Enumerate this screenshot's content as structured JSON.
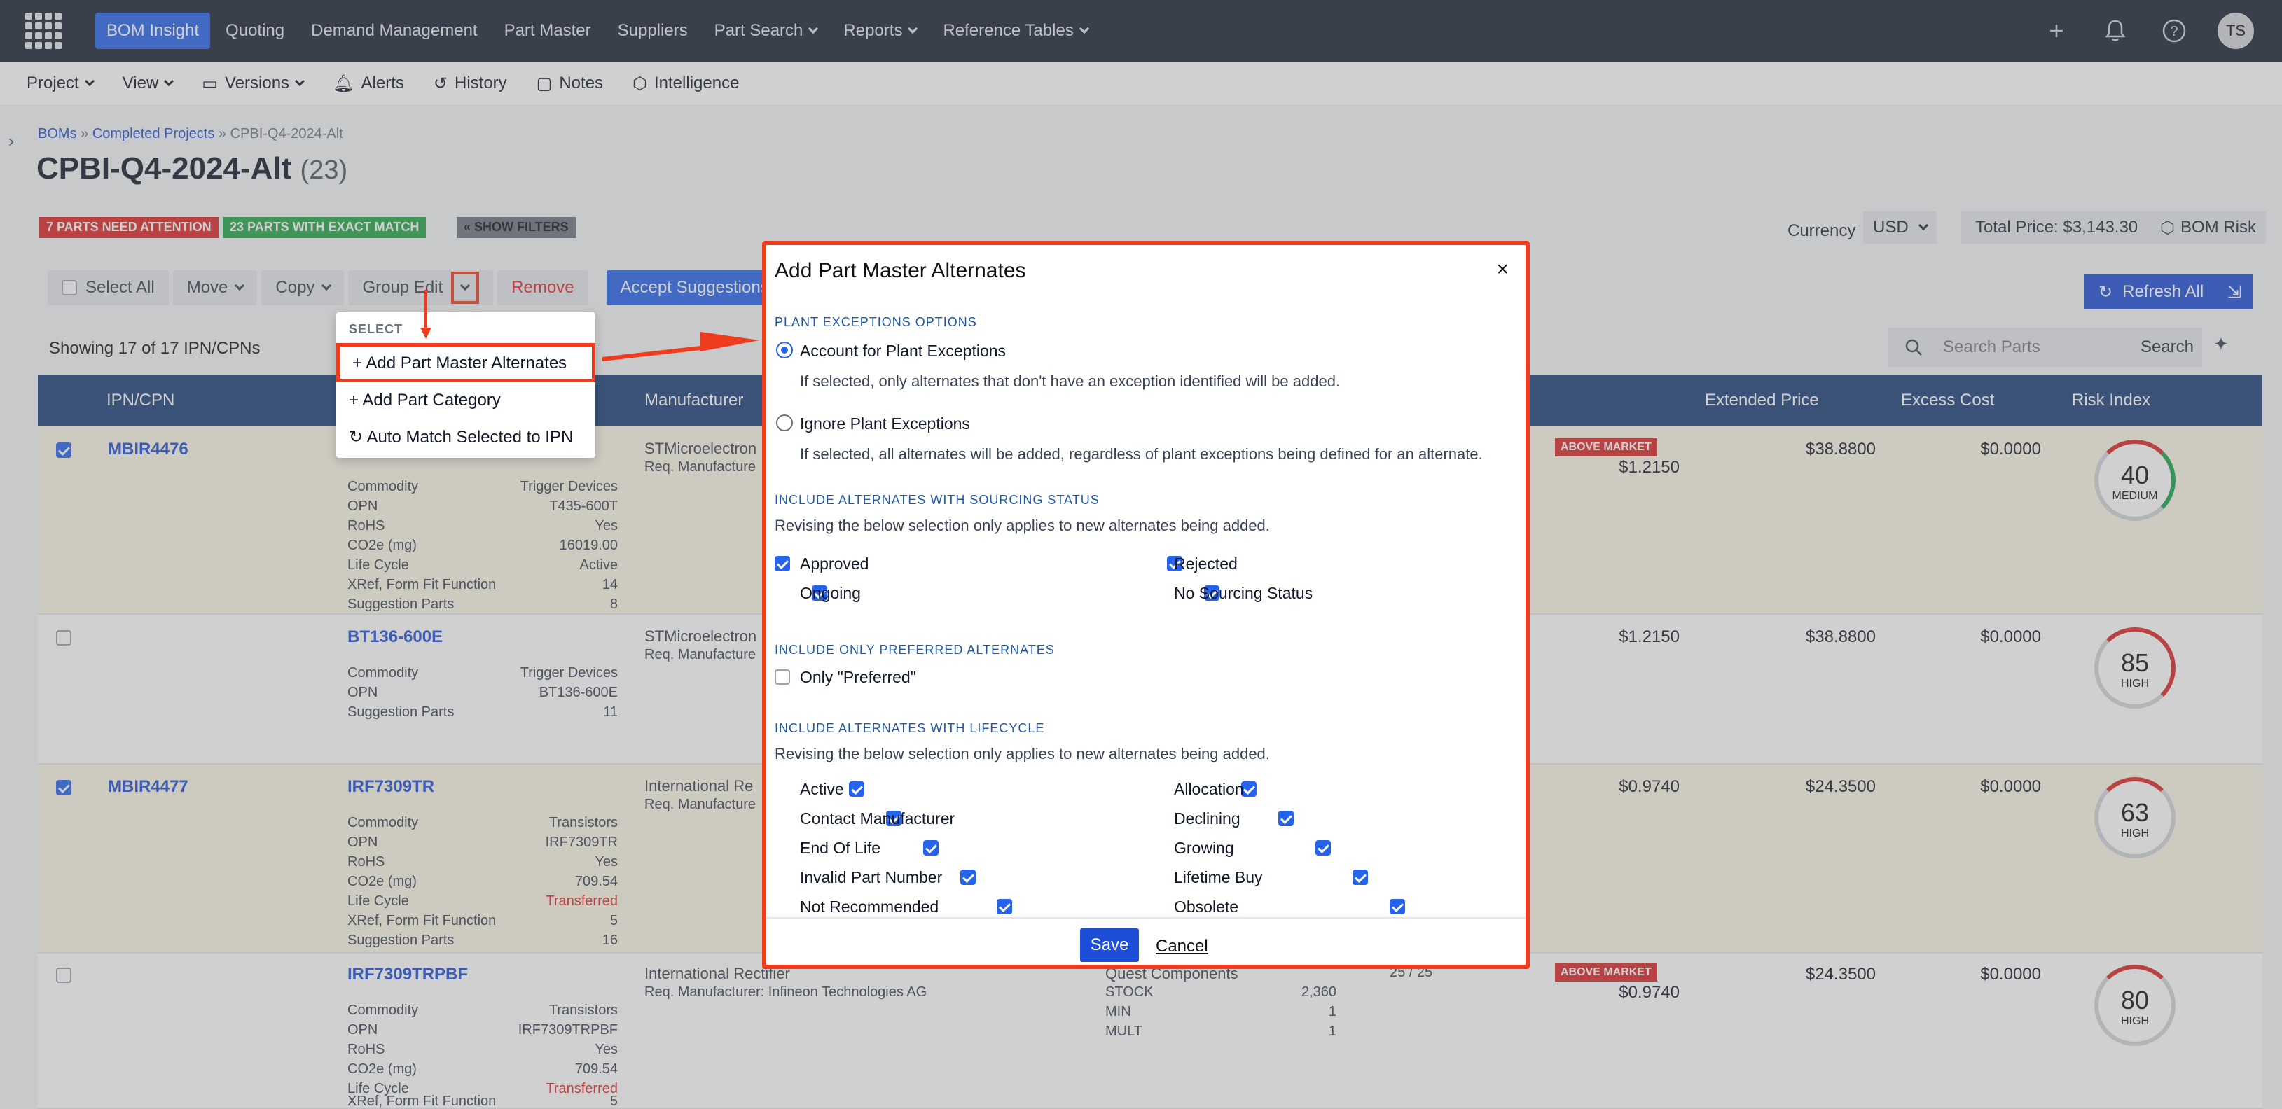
{
  "nav": {
    "items": [
      "BOM Insight",
      "Quoting",
      "Demand Management",
      "Part Master",
      "Suppliers",
      "Part Search",
      "Reports",
      "Reference Tables"
    ],
    "avatar": "TS"
  },
  "subnav": {
    "items": [
      "Project",
      "View",
      "Versions",
      "Alerts",
      "History",
      "Notes",
      "Intelligence"
    ]
  },
  "breadcrumb": {
    "a": "BOMs",
    "b": "Completed Projects",
    "c": "CPBI-Q4-2024-Alt"
  },
  "title": {
    "name": "CPBI-Q4-2024-Alt",
    "count": "(23)"
  },
  "badges": {
    "attention": "7 PARTS NEED ATTENTION",
    "exact": "23 PARTS WITH EXACT MATCH",
    "filters": "« SHOW FILTERS"
  },
  "currency": {
    "label": "Currency",
    "value": "USD",
    "total": "Total Price: $3,143.30",
    "risk": "BOM Risk"
  },
  "toolbar": {
    "select_all": "Select All",
    "move": "Move",
    "copy": "Copy",
    "group_edit": "Group Edit",
    "remove": "Remove",
    "accept": "Accept Suggestions",
    "refresh": "Refresh All",
    "search_placeholder": "Search Parts",
    "search": "Search"
  },
  "showing": "Showing 17 of 17 IPN/CPNs",
  "table": {
    "headers": [
      "IPN/CPN",
      "Manufacturer",
      "Extended Price",
      "Excess Cost",
      "Risk Index"
    ]
  },
  "dropdown": {
    "header": "SELECT",
    "options": [
      "+ Add Part Master Alternates",
      "+ Add Part Category",
      "Auto Match Selected to IPN"
    ]
  },
  "rows": [
    {
      "ipn": "MBIR4476",
      "mpn": "",
      "mfr": "STMicroelectron",
      "req": "Req. Manufacture",
      "price": "$1.2150",
      "ext": "$38.8800",
      "excess": "$0.0000",
      "risk": "40",
      "level": "MEDIUM",
      "tag": "ABOVE MARKET",
      "kv": [
        [
          "Commodity",
          "Trigger Devices"
        ],
        [
          "OPN",
          "T435-600T"
        ],
        [
          "RoHS",
          "Yes"
        ],
        [
          "CO2e (mg)",
          "16019.00"
        ],
        [
          "Life Cycle",
          "Active"
        ],
        [
          "XRef, Form Fit Function",
          "14"
        ],
        [
          "Suggestion Parts",
          "8"
        ]
      ]
    },
    {
      "ipn": "",
      "mpn": "BT136-600E",
      "mfr": "STMicroelectron",
      "req": "Req. Manufacture",
      "price": "$1.2150",
      "ext": "$38.8800",
      "excess": "$0.0000",
      "risk": "85",
      "level": "HIGH",
      "tag": "",
      "kv": [
        [
          "Commodity",
          "Trigger Devices"
        ],
        [
          "OPN",
          "BT136-600E"
        ],
        [
          "Suggestion Parts",
          "11"
        ]
      ]
    },
    {
      "ipn": "MBIR4477",
      "mpn": "IRF7309TR",
      "mfr": "International Re",
      "req": "Req. Manufacture",
      "price": "$0.9740",
      "ext": "$24.3500",
      "excess": "$0.0000",
      "risk": "63",
      "level": "HIGH",
      "tag": "",
      "kv": [
        [
          "Commodity",
          "Transistors"
        ],
        [
          "OPN",
          "IRF7309TR"
        ],
        [
          "RoHS",
          "Yes"
        ],
        [
          "CO2e (mg)",
          "709.54"
        ],
        [
          "Life Cycle",
          "Transferred"
        ],
        [
          "XRef, Form Fit Function",
          "5"
        ],
        [
          "Suggestion Parts",
          "16"
        ]
      ]
    },
    {
      "ipn": "",
      "mpn": "IRF7309TRPBF",
      "mfr": "International Rectifier",
      "req": "Req. Manufacturer: Infineon Technologies AG",
      "price": "$0.9740",
      "ext": "$24.3500",
      "excess": "$0.0000",
      "risk": "80",
      "level": "HIGH",
      "tag": "ABOVE MARKET",
      "kv": [
        [
          "Commodity",
          "Transistors"
        ],
        [
          "OPN",
          "IRF7309TRPBF"
        ],
        [
          "RoHS",
          "Yes"
        ],
        [
          "CO2e (mg)",
          "709.54"
        ],
        [
          "Life Cycle",
          "Transferred"
        ],
        [
          "XRef, Form Fit Function",
          "5"
        ]
      ],
      "supplier": "Quest Components",
      "stock": [
        [
          "STOCK",
          "2,360"
        ],
        [
          "MIN",
          "1"
        ],
        [
          "MULT",
          "1"
        ]
      ],
      "qty": "25 / 25"
    }
  ],
  "modal": {
    "title": "Add Part Master Alternates",
    "close": "×",
    "s1": "PLANT EXCEPTIONS OPTIONS",
    "r1": "Account for Plant Exceptions",
    "r1d": "If selected, only alternates that don't have an exception identified will be added.",
    "r2": "Ignore Plant Exceptions",
    "r2d": "If selected, all alternates will be added, regardless of plant exceptions being defined for an alternate.",
    "s2": "INCLUDE ALTERNATES WITH SOURCING STATUS",
    "s2d": "Revising the below selection only applies to new alternates being added.",
    "sourcing": [
      "Approved",
      "Rejected",
      "Ongoing",
      "No Sourcing Status"
    ],
    "s3": "INCLUDE ONLY PREFERRED ALTERNATES",
    "preferred": "Only \"Preferred\"",
    "s4": "INCLUDE ALTERNATES WITH LIFECYCLE",
    "s4d": "Revising the below selection only applies to new alternates being added.",
    "lifecycle": [
      "Active",
      "Allocation",
      "Contact Manufacturer",
      "Declining",
      "End Of Life",
      "Growing",
      "Invalid Part Number",
      "Lifetime Buy",
      "Not Recommended",
      "Obsolete"
    ],
    "save": "Save",
    "cancel": "Cancel"
  },
  "colors": {
    "accent": "#2563eb",
    "nav_bg": "#1a2233",
    "highlight": "#ef3b1e"
  }
}
